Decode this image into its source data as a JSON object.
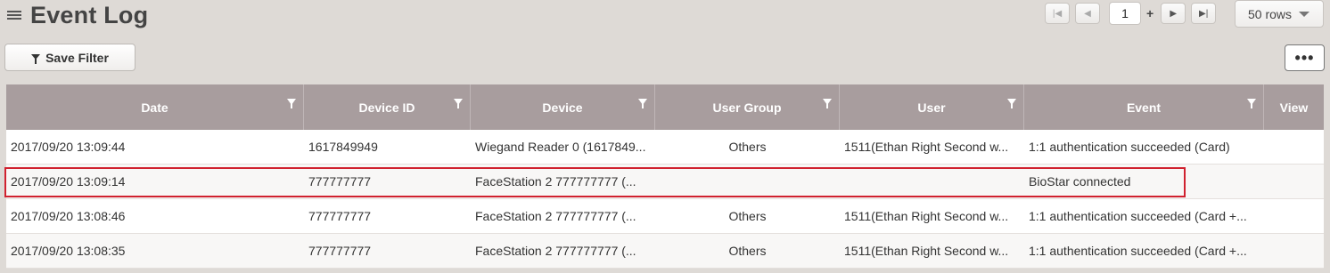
{
  "page": {
    "title": "Event Log"
  },
  "pagination": {
    "current_page": "1",
    "plus": "+",
    "rows_per_page": "50 rows"
  },
  "toolbar": {
    "save_filter_label": "Save Filter",
    "more_label": "•••"
  },
  "table": {
    "columns": [
      "Date",
      "Device ID",
      "Device",
      "User Group",
      "User",
      "Event",
      "View"
    ],
    "rows": [
      {
        "date": "2017/09/20 13:09:44",
        "device_id": "1617849949",
        "device": "Wiegand Reader 0 (1617849...",
        "user_group": "Others",
        "user": "1511(Ethan Right Second w...",
        "event": "1:1 authentication succeeded (Card)",
        "view": ""
      },
      {
        "date": "2017/09/20 13:09:14",
        "device_id": "777777777",
        "device": "FaceStation 2 777777777 (...",
        "user_group": "",
        "user": "",
        "event": "BioStar connected",
        "view": ""
      },
      {
        "date": "2017/09/20 13:08:46",
        "device_id": "777777777",
        "device": "FaceStation 2 777777777 (...",
        "user_group": "Others",
        "user": "1511(Ethan Right Second w...",
        "event": "1:1 authentication succeeded (Card +...",
        "view": ""
      },
      {
        "date": "2017/09/20 13:08:35",
        "device_id": "777777777",
        "device": "FaceStation 2 777777777 (...",
        "user_group": "Others",
        "user": "1511(Ethan Right Second w...",
        "event": "1:1 authentication succeeded (Card +...",
        "view": ""
      }
    ]
  },
  "colors": {
    "header_bg": "#a89d9e",
    "page_bg": "#dedad6",
    "highlight": "#d0212f"
  }
}
